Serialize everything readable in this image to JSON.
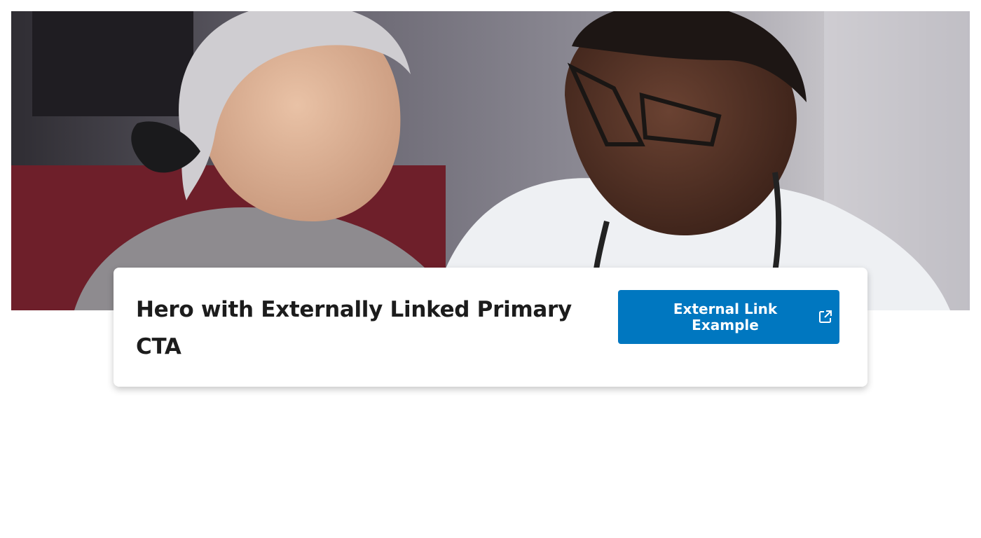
{
  "hero": {
    "title": "Hero with Externally Linked Primary CTA",
    "cta": {
      "label": "External Link Example",
      "icon": "external-link-icon"
    }
  },
  "colors": {
    "cta_background": "#0077c0",
    "title_text": "#1c1c1c",
    "card_background": "#ffffff"
  }
}
